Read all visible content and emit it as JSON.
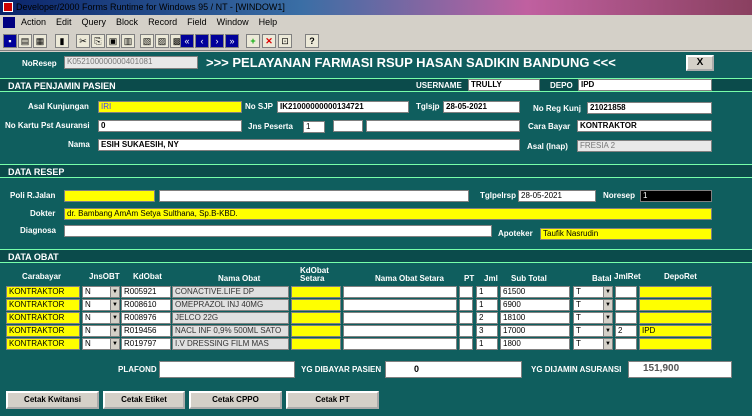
{
  "window": {
    "title": "Developer/2000 Forms Runtime for Windows 95 / NT - [WINDOW1]"
  },
  "menu": [
    "Action",
    "Edit",
    "Query",
    "Block",
    "Record",
    "Field",
    "Window",
    "Help"
  ],
  "toolbar": {
    "help": "?"
  },
  "header": {
    "norec_label": "NoResep",
    "norec_value": "K052100000000401081",
    "title": ">>> PELAYANAN FARMASI RSUP HASAN SADIKIN BANDUNG <<<",
    "close": "X"
  },
  "sections": {
    "penjamin": "DATA PENJAMIN PASIEN",
    "resep": "DATA RESEP",
    "obat": "DATA OBAT"
  },
  "penjamin": {
    "username_label": "USERNAME",
    "username": "TRULLY",
    "depo_label": "DEPO",
    "depo": "IPD",
    "asal_label": "Asal Kunjungan",
    "asal": "IRI",
    "nosjp_label": "No SJP",
    "nosjp": "IK21000000000134721",
    "tglsjp_label": "Tglsjp",
    "tglsjp": "28-05-2021",
    "noreg_label": "No Reg Kunj",
    "noreg": "21021858",
    "nokartu_label": "No Kartu Pst Asuransi",
    "nokartu": "0",
    "jns_label": "Jns Peserta",
    "jns": "1",
    "cara_label": "Cara Bayar",
    "cara": "KONTRAKTOR",
    "nama_label": "Nama",
    "nama": "ESIH SUKAESIH, NY",
    "asalinap_label": "Asal (Inap)",
    "asalinap": "FRESIA 2"
  },
  "resep": {
    "poli_label": "Poli R.Jalan",
    "poli": "",
    "tglpelrsp_label": "Tglpelrsp",
    "tglpelrsp": "28-05-2021",
    "noresep_label": "Noresep",
    "noresep": "1",
    "dokter_label": "Dokter",
    "dokter": "dr. Bambang AmAm Setya Sulthana, Sp.B-KBD.",
    "diagnosa_label": "Diagnosa",
    "diagnosa": "",
    "apoteker_label": "Apoteker",
    "apoteker": "Taufik Nasrudin"
  },
  "obat": {
    "headers": {
      "carabayar": "Carabayar",
      "jnsobt": "JnsOBT",
      "kdobat": "KdObat",
      "nama": "Nama Obat",
      "kdsetara1": "KdObat",
      "kdsetara2": "Setara",
      "namasetara": "Nama Obat Setara",
      "pt": "PT",
      "jml": "Jml",
      "subtotal": "Sub Total",
      "batal": "Batal",
      "jmlret": "JmlRet",
      "deporet": "DepoRet"
    },
    "rows": [
      {
        "carabayar": "KONTRAKTOR",
        "jns": "N",
        "kd": "R005921",
        "nama": "CONACTIVE.LIFE DP",
        "jml": "1",
        "sub": "61500",
        "batal": "T",
        "jmlret": "",
        "deporet": ""
      },
      {
        "carabayar": "KONTRAKTOR",
        "jns": "N",
        "kd": "R008610",
        "nama": "OMEPRAZOL INJ 40MG",
        "jml": "1",
        "sub": "6900",
        "batal": "T",
        "jmlret": "",
        "deporet": ""
      },
      {
        "carabayar": "KONTRAKTOR",
        "jns": "N",
        "kd": "R008976",
        "nama": "JELCO 22G",
        "jml": "2",
        "sub": "18100",
        "batal": "T",
        "jmlret": "",
        "deporet": ""
      },
      {
        "carabayar": "KONTRAKTOR",
        "jns": "N",
        "kd": "R019456",
        "nama": "NACL INF 0,9% 500ML SATO",
        "jml": "3",
        "sub": "17000",
        "batal": "T",
        "jmlret": "2",
        "deporet": "IPD"
      },
      {
        "carabayar": "KONTRAKTOR",
        "jns": "N",
        "kd": "R019797",
        "nama": "I.V DRESSING FILM MAS",
        "jml": "1",
        "sub": "1800",
        "batal": "T",
        "jmlret": "",
        "deporet": ""
      }
    ]
  },
  "totals": {
    "plafond_label": "PLAFOND",
    "plafond": "",
    "dibayar_label": "YG DIBAYAR PASIEN",
    "dibayar": "0",
    "dijamin_label": "YG DIJAMIN ASURANSI",
    "dijamin": "151,900"
  },
  "buttons": {
    "kwitansi": "Cetak Kwitansi",
    "etiket": "Cetak Etiket",
    "cppo": "Cetak CPPO",
    "pt": "Cetak PT"
  }
}
